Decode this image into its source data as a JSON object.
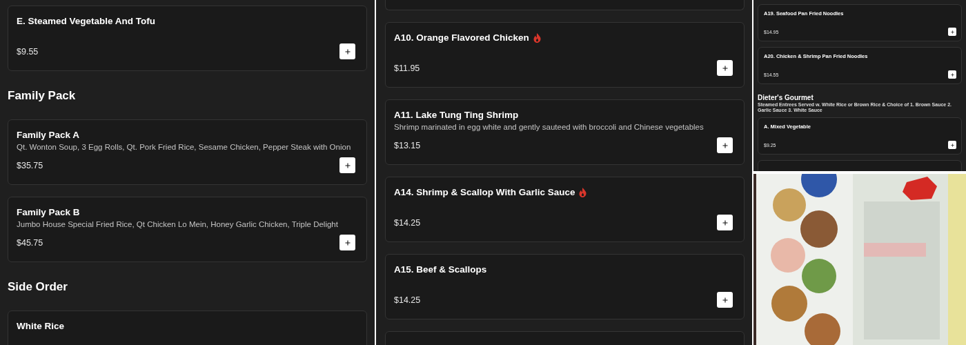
{
  "columns": [
    {
      "entries": [
        {
          "kind": "card",
          "name": "E. Steamed Vegetable And Tofu",
          "price": "$9.55",
          "spicy": false
        },
        {
          "kind": "heading",
          "text": "Family Pack"
        },
        {
          "kind": "card",
          "name": "Family Pack A",
          "description": "Qt. Wonton Soup, 3 Egg Rolls, Qt. Pork Fried Rice, Sesame Chicken, Pepper Steak with Onion",
          "price": "$35.75",
          "spicy": false
        },
        {
          "kind": "card",
          "name": "Family Pack B",
          "description": "Jumbo House Special Fried Rice, Qt Chicken Lo Mein, Honey Garlic Chicken, Triple Delight",
          "price": "$45.75",
          "spicy": false
        },
        {
          "kind": "heading",
          "text": "Side Order"
        },
        {
          "kind": "card",
          "name": "White Rice",
          "spicy": false
        }
      ]
    },
    {
      "entries": [
        {
          "kind": "card_edge"
        },
        {
          "kind": "card",
          "name": "A10. Orange Flavored Chicken",
          "price": "$11.95",
          "spicy": true
        },
        {
          "kind": "card",
          "name": "A11. Lake Tung Ting Shrimp",
          "description": "Shrimp marinated in egg white and gently sauteed with broccoli and Chinese vegetables",
          "price": "$13.15",
          "spicy": false
        },
        {
          "kind": "card",
          "name": "A14. Shrimp & Scallop With Garlic Sauce",
          "price": "$14.25",
          "spicy": true
        },
        {
          "kind": "card",
          "name": "A15. Beef & Scallops",
          "price": "$14.25",
          "spicy": false
        },
        {
          "kind": "card_edge"
        }
      ]
    },
    {
      "entries": [
        {
          "kind": "card",
          "name": "A19. Seafood Pan Fried Noodles",
          "price": "$14.95",
          "spicy": false
        },
        {
          "kind": "card",
          "name": "A20. Chicken & Shrimp Pan Fried Noodles",
          "price": "$14.55",
          "spicy": false
        },
        {
          "kind": "heading",
          "text": "Dieter's Gourmet"
        },
        {
          "kind": "note",
          "text": "Steamed Entrees Served w. White Rice or Brown Rice & Choice of 1. Brown Sauce 2. Garlic Sauce 3. White Sauce"
        },
        {
          "kind": "card",
          "name": "A. Mixed Vegetable",
          "price": "$9.25",
          "spicy": false
        },
        {
          "kind": "card_edge"
        }
      ]
    }
  ]
}
